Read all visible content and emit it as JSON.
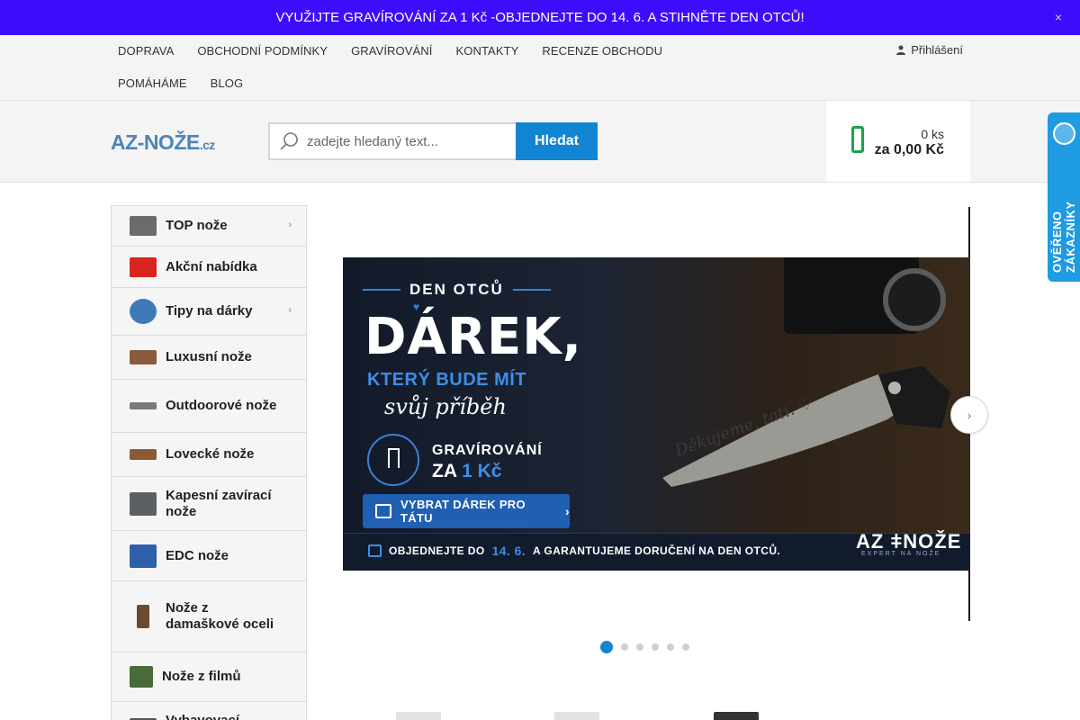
{
  "promo": {
    "text": "  VYUŽIJTE GRAVÍROVÁNÍ ZA 1 Kč -OBJEDNEJTE DO 14. 6. A STIHNĚTE DEN OTCŮ!",
    "close": "×"
  },
  "topnav": {
    "links": [
      "DOPRAVA",
      "OBCHODNÍ PODMÍNKY",
      "GRAVÍROVÁNÍ",
      "KONTAKTY",
      "RECENZE OBCHODU",
      "POMÁHÁME",
      "BLOG"
    ],
    "login": "Přihlášení"
  },
  "header": {
    "logo_main": "AZ-NOŽE",
    "logo_suffix": ".cz",
    "search_placeholder": "zadejte hledaný text...",
    "search_button": "Hledat",
    "cart_qty": "0 ks",
    "cart_price": "za 0,00 Kč"
  },
  "trust_badge": {
    "text": "OVĚŘENO ZÁKAZNÍKY"
  },
  "sidebar": {
    "categories": [
      {
        "label": " TOP nože",
        "has_submenu": true,
        "thumb_color": "#6b6b6b"
      },
      {
        "label": "Akční nabídka",
        "has_submenu": false,
        "thumb_color": "#d8231f"
      },
      {
        "label": "Tipy na dárky",
        "has_submenu": true,
        "thumb_color": "#3f79b5"
      },
      {
        "label": "Luxusní nože",
        "has_submenu": false,
        "thumb_color": "#8a5a3a"
      },
      {
        "label": "Outdoorové nože",
        "has_submenu": false,
        "thumb_color": "#7a7a7a"
      },
      {
        "label": "Lovecké nože",
        "has_submenu": false,
        "thumb_color": "#8b5a32"
      },
      {
        "label": "Kapesní zavírací nože",
        "has_submenu": false,
        "thumb_color": "#5b5f66"
      },
      {
        "label": "EDC nože",
        "has_submenu": false,
        "thumb_color": "#2f5fa8"
      },
      {
        "label": "Nože z damaškové oceli",
        "has_submenu": false,
        "thumb_color": "#6a4a30"
      },
      {
        "label": "Nože z filmů",
        "has_submenu": false,
        "thumb_color": "#4a6a3a"
      },
      {
        "label": "Vybavovací",
        "has_submenu": false,
        "thumb_color": "#555555"
      }
    ],
    "arrow_glyph": "›"
  },
  "slider": {
    "slide": {
      "sup": "DEN OTCŮ",
      "heart": "♥",
      "big": "DÁREK,",
      "sub1": "KTERÝ BUDE MÍT",
      "sub2": "svůj příběh",
      "engrave_line1": "GRAVÍROVÁNÍ",
      "engrave_line2_prefix": "ZA ",
      "engrave_line2_value": "1 Kč",
      "cta": "VYBRAT DÁREK PRO TÁTU",
      "cta_chevron": "›",
      "foot_prefix": "OBJEDNEJTE DO",
      "foot_date": "14. 6.",
      "foot_suffix": "A GARANTUJEME DORUČENÍ NA DEN OTCŮ.",
      "brand": "AZ ǂNOŽE",
      "brand_sub": "EXPERT NA NOŽE",
      "script": "Děkujeme, tati. ♡"
    },
    "next_glyph": "›",
    "dots": 6,
    "active_dot": 0
  },
  "colors": {
    "promo_bg": "#3c0dfa",
    "accent_blue": "#1284d4",
    "cart_green": "#1aa34a",
    "trust_blue": "#1e9be1"
  }
}
